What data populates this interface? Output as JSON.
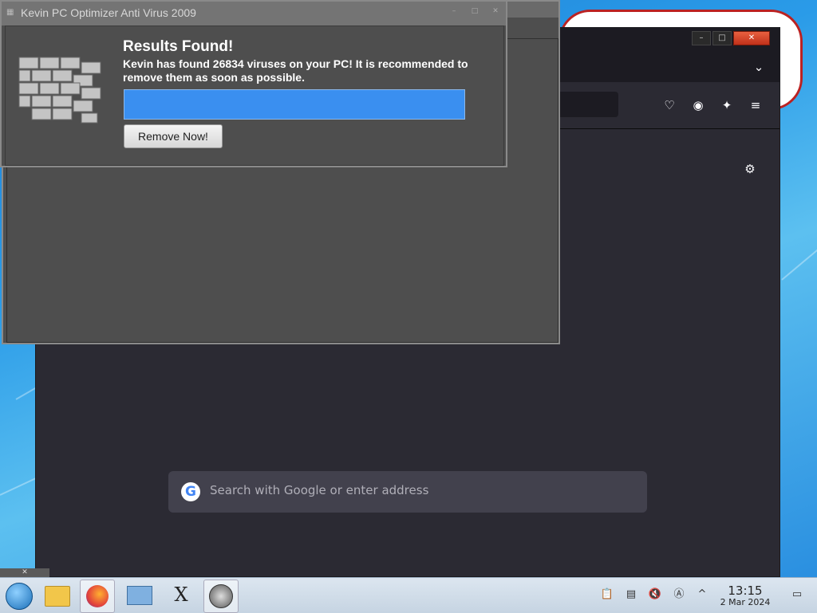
{
  "popup": {
    "title": "Kevin PC Optimizer Anti Virus 2009",
    "heading": "Results Found!",
    "message": "Kevin has found 26834 viruses on your PC! It is recommended to remove them as soon as possible.",
    "button_label": "Remove Now!",
    "progress_fraction": 1.0,
    "progress_color": "#3a8ff0"
  },
  "browser": {
    "search_placeholder": "Search with Google or enter address",
    "google_glyph": "G"
  },
  "taskbar": {
    "clock_time": "13:15",
    "clock_date": "2 Mar 2024"
  },
  "icons": [
    "start-orb-icon",
    "file-manager-icon",
    "firefox-icon",
    "control-panel-icon",
    "x-app-icon",
    "safari-icon",
    "clipboard-icon",
    "notes-icon",
    "volume-muted-icon",
    "keyboard-icon",
    "chevron-up-icon",
    "show-desktop-icon",
    "settings-gear-icon",
    "pocket-icon",
    "account-icon",
    "extensions-icon",
    "menu-icon"
  ],
  "colors": {
    "accent": "#3a8ff0",
    "browser_bg": "#2b2a33",
    "popup_bg": "#4e4e4e"
  }
}
